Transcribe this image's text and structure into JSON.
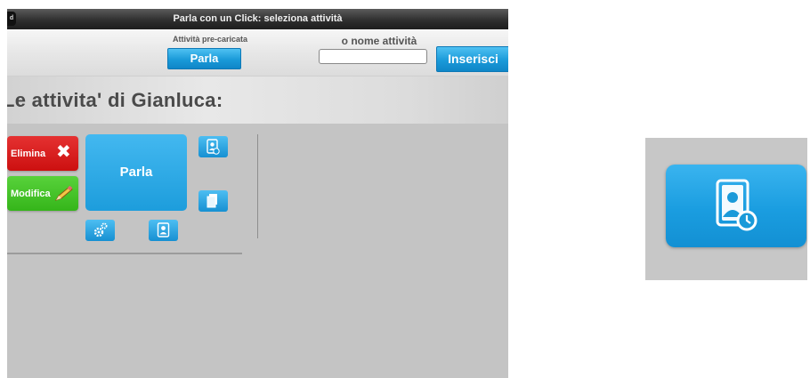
{
  "window": {
    "title": "Parla con un Click: seleziona attività",
    "corner_glyph": "d"
  },
  "toolbar": {
    "preloaded_label": "Attività pre-caricata",
    "preloaded_button": "Parla",
    "name_label": "o nome attività",
    "name_input_value": "",
    "insert_button": "Inserisci"
  },
  "header": {
    "title": "Le attivita' di Gianluca:"
  },
  "activity": {
    "delete_label": "Elimina",
    "edit_label": "Modifica",
    "main_label": "Parla"
  },
  "icons": {
    "close": "x-icon",
    "edit": "pencil-icon",
    "contact_clock": "contact-clock-icon",
    "document": "document-icon",
    "settings": "gears-icon",
    "contact": "contact-icon"
  },
  "colors": {
    "accent_blue": "#1a9ad9",
    "delete_red": "#d61919",
    "edit_green": "#41c025"
  }
}
